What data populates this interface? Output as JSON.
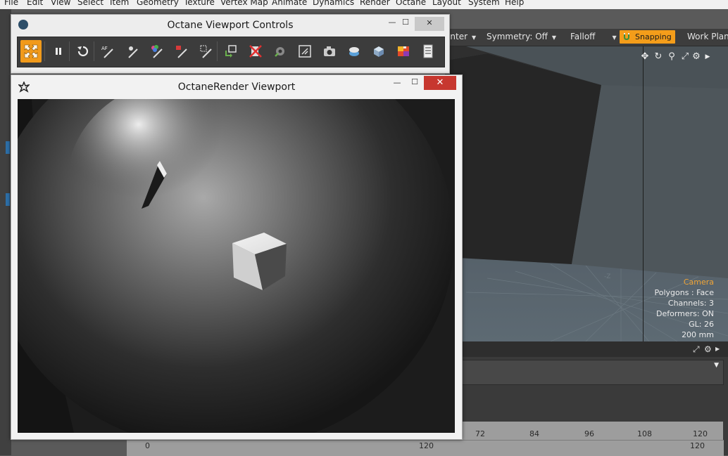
{
  "menubar": {
    "items": [
      "File",
      "Edit",
      "View",
      "Select",
      "Item",
      "Geometry",
      "Texture",
      "Vertex Map",
      "Animate",
      "Dynamics",
      "Render",
      "Octane",
      "Layout",
      "System",
      "Help"
    ]
  },
  "toolbar": {
    "center_label": "enter",
    "symmetry_label": "Symmetry: Off",
    "falloff_label": "Falloff",
    "snapping_label": "Snapping",
    "work_plane_label": "Work Plane"
  },
  "viewport": {
    "axis_label": "-Z",
    "info": {
      "camera": "Camera",
      "polygons": "Polygons : Face",
      "channels": "Channels: 3",
      "deformers": "Deformers: ON",
      "gl": "GL: 26",
      "unit": "200 mm"
    }
  },
  "ovc_window": {
    "title": "Octane Viewport Controls",
    "minimize": "—",
    "maximize": "☐",
    "close": "✕",
    "buttons": [
      {
        "icon": "expand-arrows-icon",
        "active": true
      },
      {
        "icon": "pause-icon",
        "active": false
      },
      {
        "icon": "restart-icon",
        "active": false
      },
      {
        "icon": "autofocus-picker-icon",
        "active": false
      },
      {
        "icon": "focus-picker-icon",
        "active": false
      },
      {
        "icon": "material-picker-icon",
        "active": false
      },
      {
        "icon": "object-picker-icon",
        "active": false
      },
      {
        "icon": "region-picker-icon",
        "active": false
      },
      {
        "icon": "export-icon",
        "active": false
      },
      {
        "icon": "clear-icon",
        "active": false
      },
      {
        "icon": "lock-settings-icon",
        "active": false
      },
      {
        "icon": "region-render-icon",
        "active": false
      },
      {
        "icon": "camera-icon",
        "active": false
      },
      {
        "icon": "environment-icon",
        "active": false
      },
      {
        "icon": "cube-icon",
        "active": false
      },
      {
        "icon": "color-swatch-icon",
        "active": false
      },
      {
        "icon": "settings-list-icon",
        "active": false
      }
    ]
  },
  "orv_window": {
    "title": "OctaneRender Viewport",
    "minimize": "—",
    "maximize": "☐",
    "close": "✕"
  },
  "timeline": {
    "top_ticks": [
      "72",
      "84",
      "96",
      "108",
      "120"
    ],
    "bottom_start": "0",
    "bottom_mid": "120",
    "bottom_end": "120"
  }
}
